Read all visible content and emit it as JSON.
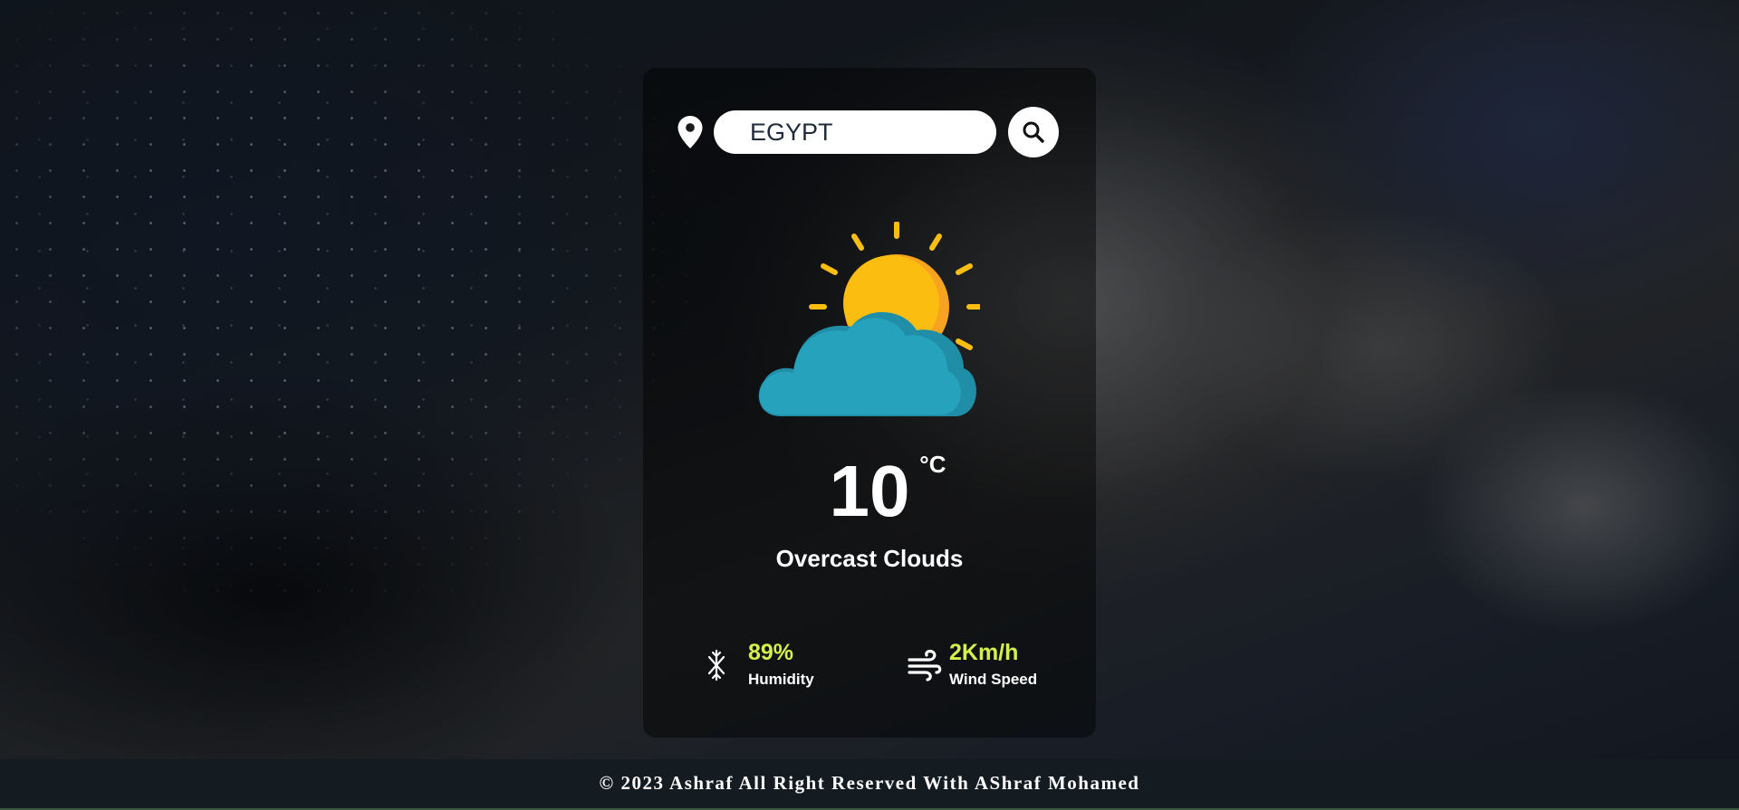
{
  "search": {
    "value": "EGYPT",
    "location_icon": "map-pin-icon",
    "button_icon": "magnifier-icon"
  },
  "weather": {
    "icon": "sun-behind-cloud-icon",
    "temperature": "10",
    "unit": "°C",
    "description": "Overcast Clouds"
  },
  "details": {
    "humidity": {
      "icon": "humidity-icon",
      "value": "89%",
      "label": "Humidity"
    },
    "wind": {
      "icon": "wind-icon",
      "value": "2Km/h",
      "label": "Wind Speed"
    }
  },
  "footer": {
    "text": "© 2023 Ashraf All Right Reserved With AShraf Mohamed"
  },
  "colors": {
    "accent": "#d3f14a",
    "cloud": "#27a2bd",
    "sun": "#fbbd10",
    "footer_bg": "#141c22"
  }
}
